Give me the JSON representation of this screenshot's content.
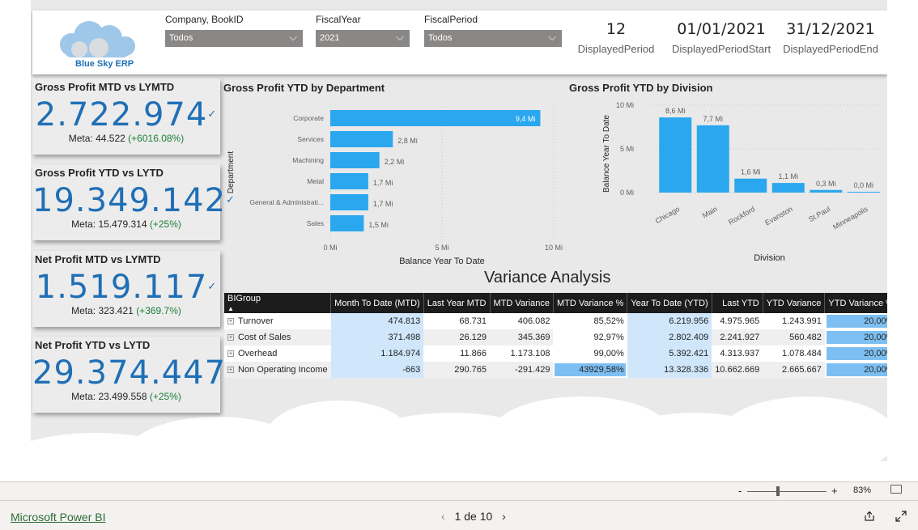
{
  "logo": {
    "text": "Blue Sky ERP"
  },
  "slicers": [
    {
      "label": "Company, BookID",
      "value": "Todos"
    },
    {
      "label": "FiscalYear",
      "value": "2021"
    },
    {
      "label": "FiscalPeriod",
      "value": "Todos"
    }
  ],
  "top_cards": [
    {
      "value": "12",
      "label": "DisplayedPeriod"
    },
    {
      "value": "01/01/2021",
      "label": "DisplayedPeriodStart"
    },
    {
      "value": "31/12/2021",
      "label": "DisplayedPeriodEnd"
    }
  ],
  "kpis": [
    {
      "title": "Gross Profit MTD vs LYMTD",
      "value": "2.722.974",
      "meta_prefix": "Meta: 44.522",
      "meta_pct": "(+6016.08%)"
    },
    {
      "title": "Gross Profit YTD vs LYTD",
      "value": "19.349.142",
      "meta_prefix": "Meta: 15.479.314",
      "meta_pct": "(+25%)"
    },
    {
      "title": "Net Profit MTD vs LYMTD",
      "value": "1.519.117",
      "meta_prefix": "Meta: 323.421",
      "meta_pct": "(+369.7%)"
    },
    {
      "title": "Net Profit YTD vs LYTD",
      "value": "29.374.447",
      "meta_prefix": "Meta: 23.499.558",
      "meta_pct": "(+25%)"
    }
  ],
  "chart_data": [
    {
      "type": "bar",
      "orientation": "horizontal",
      "title": "Gross Profit YTD by Department",
      "xlabel": "Balance Year To Date",
      "ylabel": "Department",
      "categories": [
        "Corporate",
        "Services",
        "Machining",
        "Metal",
        "General & Administrati...",
        "Sales"
      ],
      "values": [
        9.4,
        2.8,
        2.2,
        1.7,
        1.7,
        1.5
      ],
      "data_labels": [
        "9,4 Mi",
        "2,8 Mi",
        "2,2 Mi",
        "1,7 Mi",
        "1,7 Mi",
        "1,5 Mi"
      ],
      "xticks": [
        "0 Mi",
        "5 Mi",
        "10 Mi"
      ],
      "xlim": [
        0,
        10
      ],
      "color": "#2aa7ee"
    },
    {
      "type": "bar",
      "orientation": "vertical",
      "title": "Gross Profit YTD by Division",
      "xlabel": "Division",
      "ylabel": "Balance Year To Date",
      "categories": [
        "Chicago",
        "Main",
        "Rockford",
        "Evanston",
        "St.Paul",
        "Minneapolis"
      ],
      "values": [
        8.6,
        7.7,
        1.6,
        1.1,
        0.3,
        0.0
      ],
      "data_labels": [
        "8,6 Mi",
        "7,7 Mi",
        "1,6 Mi",
        "1,1 Mi",
        "0,3 Mi",
        "0,0 Mi"
      ],
      "yticks": [
        "10 Mi",
        "5 Mi",
        "0 Mi"
      ],
      "ylim": [
        0,
        10
      ],
      "color": "#2aa7ee"
    }
  ],
  "variance": {
    "title": "Variance Analysis",
    "columns": [
      "BIGroup",
      "Month To Date (MTD)",
      "Last Year MTD",
      "MTD Variance",
      "MTD Variance %",
      "Year To Date (YTD)",
      "Last YTD",
      "YTD Variance",
      "YTD Variance %"
    ],
    "rows": [
      {
        "group": "Turnover",
        "mtd": "474.813",
        "ly_mtd": "68.731",
        "mtd_var": "406.082",
        "mtd_pct": "85,52%",
        "mtd_pct_fill": 0.0,
        "ytd": "6.219.956",
        "last_ytd": "4.975.965",
        "ytd_var": "1.243.991",
        "ytd_pct": "20,00%",
        "ytd_pct_fill": 1.0
      },
      {
        "group": "Cost of Sales",
        "mtd": "371.498",
        "ly_mtd": "26.129",
        "mtd_var": "345.369",
        "mtd_pct": "92,97%",
        "mtd_pct_fill": 0.0,
        "ytd": "2.802.409",
        "last_ytd": "2.241.927",
        "ytd_var": "560.482",
        "ytd_pct": "20,00%",
        "ytd_pct_fill": 1.0
      },
      {
        "group": "Overhead",
        "mtd": "1.184.974",
        "ly_mtd": "11.866",
        "mtd_var": "1.173.108",
        "mtd_pct": "99,00%",
        "mtd_pct_fill": 0.0,
        "ytd": "5.392.421",
        "last_ytd": "4.313.937",
        "ytd_var": "1.078.484",
        "ytd_pct": "20,00%",
        "ytd_pct_fill": 1.0
      },
      {
        "group": "Non Operating Income",
        "mtd": "-663",
        "ly_mtd": "290.765",
        "mtd_var": "-291.429",
        "mtd_pct": "43929,58%",
        "mtd_pct_fill": 1.0,
        "ytd": "13.328.336",
        "last_ytd": "10.662.669",
        "ytd_var": "2.665.667",
        "ytd_pct": "20,00%",
        "ytd_pct_fill": 1.0
      }
    ]
  },
  "zoom": {
    "minus": "-",
    "plus": "+",
    "level": "83%"
  },
  "footer": {
    "link": "Microsoft Power BI",
    "page": "1 de 10",
    "prev": "‹",
    "next": "›"
  }
}
